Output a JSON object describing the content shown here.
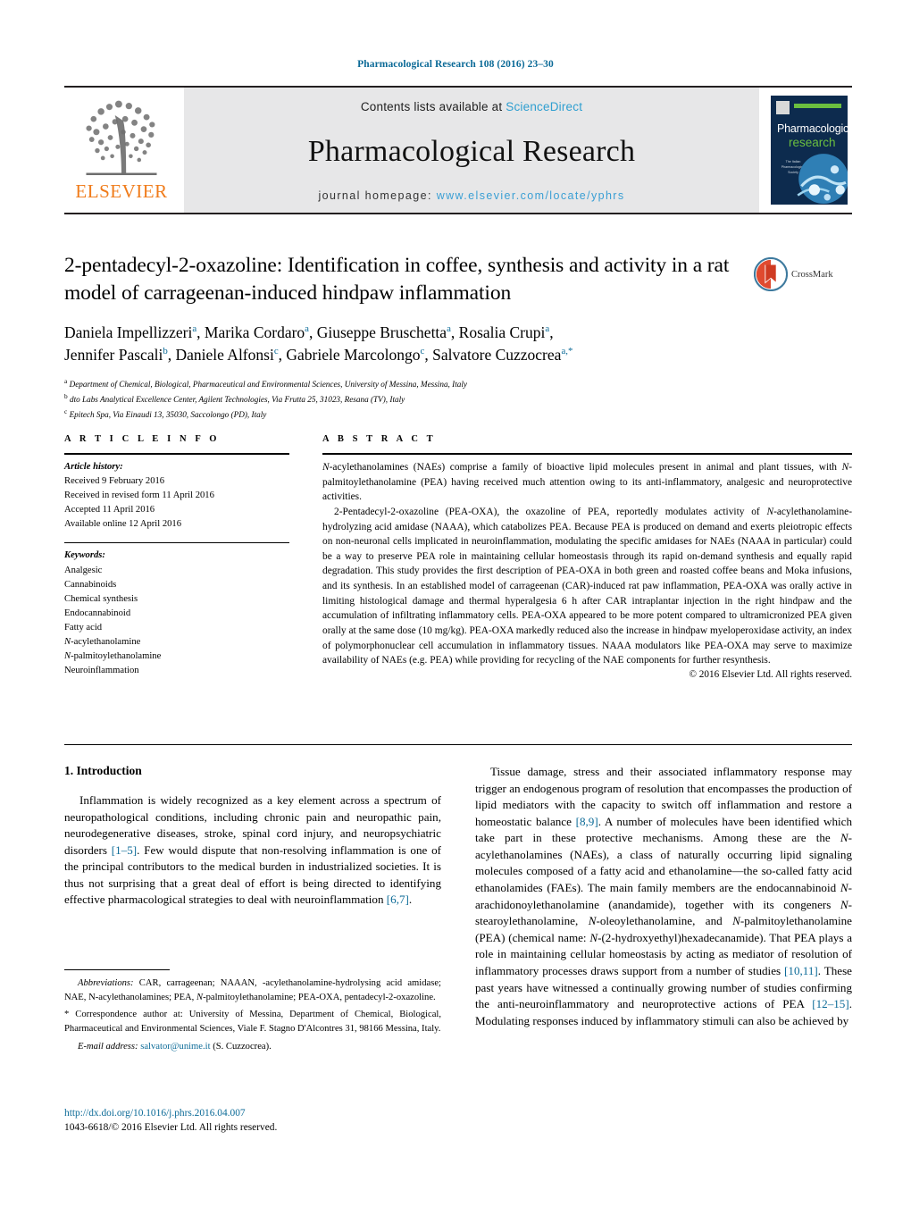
{
  "running_head": "Pharmacological Research 108 (2016) 23–30",
  "masthead": {
    "publisher_name": "ELSEVIER",
    "contents_prefix": "Contents lists available at ",
    "contents_link": "ScienceDirect",
    "journal_title": "Pharmacological Research",
    "homepage_prefix": "journal homepage: ",
    "homepage_url": "www.elsevier.com/locate/yphrs",
    "cover": {
      "line1": "Pharmacological",
      "line2": "research",
      "society_text": "The Italian Pharmacological Society"
    }
  },
  "article": {
    "title": "2-pentadecyl-2-oxazoline: Identification in coffee, synthesis and activity in a rat model of carrageenan-induced hindpaw inflammation",
    "crossmark_label": "CrossMark",
    "authors_line1": "Daniela Impellizzeri<sup>a</sup>, Marika Cordaro<sup>a</sup>, Giuseppe Bruschetta<sup>a</sup>, Rosalia Crupi<sup>a</sup>,",
    "authors_line2": "Jennifer Pascali<sup>b</sup>, Daniele Alfonsi<sup>c</sup>, Gabriele Marcolongo<sup>c</sup>, Salvatore Cuzzocrea<sup>a,</sup><sup>*</sup>",
    "affiliations": [
      "<sup>a</sup> Department of Chemical, Biological, Pharmaceutical and Environmental Sciences, University of Messina, Messina, Italy",
      "<sup>b</sup> dto Labs Analytical Excellence Center, Agilent Technologies, Via Frutta 25, 31023, Resana (TV), Italy",
      "<sup>c</sup> Epitech Spa, Via Einaudi 13, 35030, Saccolongo (PD), Italy"
    ]
  },
  "article_info": {
    "heading": "A R T I C L E  I N F O",
    "history_label": "Article history:",
    "history": [
      "Received 9 February 2016",
      "Received in revised form 11 April 2016",
      "Accepted 11 April 2016",
      "Available online 12 April 2016"
    ],
    "keywords_label": "Keywords:",
    "keywords": [
      "Analgesic",
      "Cannabinoids",
      "Chemical synthesis",
      "Endocannabinoid",
      "Fatty acid",
      "<i>N</i>-acylethanolamine",
      "<i>N</i>-palmitoylethanolamine",
      "Neuroinflammation"
    ]
  },
  "abstract": {
    "heading": "A B S T R A C T",
    "paragraphs": [
      "<i>N</i>-acylethanolamines (NAEs) comprise a family of bioactive lipid molecules present in animal and plant tissues, with <i>N</i>-palmitoylethanolamine (PEA) having received much attention owing to its anti-inflammatory, analgesic and neuroprotective activities.",
      "2-Pentadecyl-2-oxazoline (PEA-OXA), the oxazoline of PEA, reportedly modulates activity of <i>N</i>-acylethanolamine-hydrolyzing acid amidase (NAAA), which catabolizes PEA. Because PEA is produced on demand and exerts pleiotropic effects on non-neuronal cells implicated in neuroinflammation, modulating the specific amidases for NAEs (NAAA in particular) could be a way to preserve PEA role in maintaining cellular homeostasis through its rapid on-demand synthesis and equally rapid degradation. This study provides the first description of PEA-OXA in both green and roasted coffee beans and Moka infusions, and its synthesis. In an established model of carrageenan (CAR)-induced rat paw inflammation, PEA-OXA was orally active in limiting histological damage and thermal hyperalgesia 6 h after CAR intraplantar injection in the right hindpaw and the accumulation of infiltrating inflammatory cells. PEA-OXA appeared to be more potent compared to ultramicronized PEA given orally at the same dose (10 mg/kg). PEA-OXA markedly reduced also the increase in hindpaw myeloperoxidase activity, an index of polymorphonuclear cell accumulation in inflammatory tissues. NAAA modulators like PEA-OXA may serve to maximize availability of NAEs (e.g. PEA) while providing for recycling of the NAE components for further resynthesis."
    ],
    "copyright": "© 2016 Elsevier Ltd. All rights reserved."
  },
  "body": {
    "section_heading": "1. Introduction",
    "left_paragraph": "Inflammation is widely recognized as a key element across a spectrum of neuropathological conditions, including chronic pain and neuropathic pain, neurodegenerative diseases, stroke, spinal cord injury, and neuropsychiatric disorders <span class=\"ref\">[1–5]</span>. Few would dispute that non-resolving inflammation is one of the principal contributors to the medical burden in industrialized societies. It is thus not surprising that a great deal of effort is being directed to identifying effective pharmacological strategies to deal with neuroinflammation <span class=\"ref\">[6,7]</span>.",
    "right_paragraph": "Tissue damage, stress and their associated inflammatory response may trigger an endogenous program of resolution that encompasses the production of lipid mediators with the capacity to switch off inflammation and restore a homeostatic balance <span class=\"ref\">[8,9]</span>. A number of molecules have been identified which take part in these protective mechanisms. Among these are the <i>N</i>-acylethanolamines (NAEs), a class of naturally occurring lipid signaling molecules composed of a fatty acid and ethanolamine—the so-called fatty acid ethanolamides (FAEs). The main family members are the endocannabinoid <i>N</i>-arachidonoylethanolamine (anandamide), together with its congeners <i>N</i>-stearoylethanolamine, <i>N</i>-oleoylethanolamine, and <i>N</i>-palmitoylethanolamine (PEA) (chemical name: <i>N</i>-(2-hydroxyethyl)hexadecanamide). That PEA plays a role in maintaining cellular homeostasis by acting as mediator of resolution of inflammatory processes draws support from a number of studies <span class=\"ref\">[10,11]</span>. These past years have witnessed a continually growing number of studies confirming the anti-neuroinflammatory and neuroprotective actions of PEA <span class=\"ref\">[12–15]</span>. Modulating responses induced by inflammatory stimuli can also be achieved by"
  },
  "footnotes": {
    "abbreviations": "<i>Abbreviations:</i> CAR, carrageenan; NAAAN, -acylethanolamine-hydrolysing acid amidase; NAE, N-acylethanolamines; PEA, <i>N</i>-palmitoylethanolamine; PEA-OXA, pentadecyl-2-oxazoline.",
    "correspondence": "* Correspondence author at: University of Messina, Department of Chemical, Biological, Pharmaceutical and Environmental Sciences, Viale F. Stagno D'Alcontres 31, 98166 Messina, Italy.",
    "email_label": "E-mail address:",
    "email": "salvator@unime.it",
    "email_suffix": "(S. Cuzzocrea)."
  },
  "footer": {
    "doi": "http://dx.doi.org/10.1016/j.phrs.2016.04.007",
    "issn_line": "1043-6618/© 2016 Elsevier Ltd. All rights reserved."
  },
  "colors": {
    "link_blue": "#0b6a97",
    "sciencedirect_blue": "#2f9fd0",
    "elsevier_orange": "#f07c1b",
    "cover_navy": "#0d2b4e",
    "cover_green": "#6bbf3f"
  }
}
